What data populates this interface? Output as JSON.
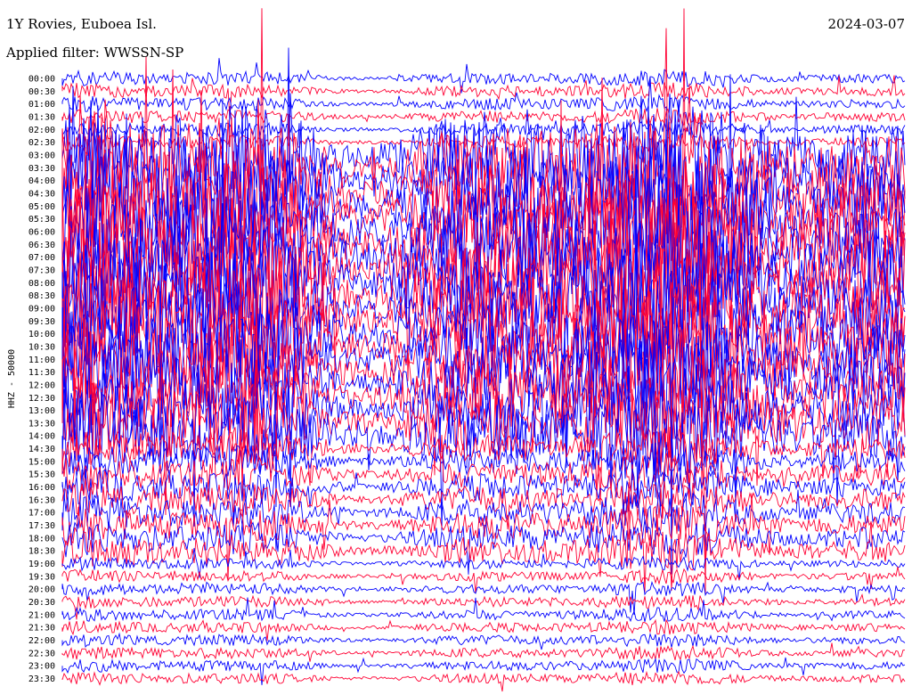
{
  "header": {
    "station_title": "1Y Rovies, Euboea Isl.",
    "filter_text": "Applied filter: WWSSN-SP",
    "date": "2024-03-07"
  },
  "chart_data": {
    "type": "line",
    "title": "1Y Rovies, Euboea Isl.",
    "ylabel": "HHZ - 50000",
    "y_tick_labels": [
      "00:00",
      "00:30",
      "01:00",
      "01:30",
      "02:00",
      "02:30",
      "03:00",
      "03:30",
      "04:00",
      "04:30",
      "05:00",
      "05:30",
      "06:00",
      "06:30",
      "07:00",
      "07:30",
      "08:00",
      "08:30",
      "09:00",
      "09:30",
      "10:00",
      "10:30",
      "11:00",
      "11:30",
      "12:00",
      "12:30",
      "13:00",
      "13:30",
      "14:00",
      "14:30",
      "15:00",
      "15:30",
      "16:00",
      "16:30",
      "17:00",
      "17:30",
      "18:00",
      "18:30",
      "19:00",
      "19:30",
      "20:00",
      "20:30",
      "21:00",
      "21:30",
      "22:00",
      "22:30",
      "23:00",
      "23:30"
    ],
    "series_colors": [
      "#0000ff",
      "#ff0033"
    ],
    "grid": false,
    "legend": "none"
  }
}
